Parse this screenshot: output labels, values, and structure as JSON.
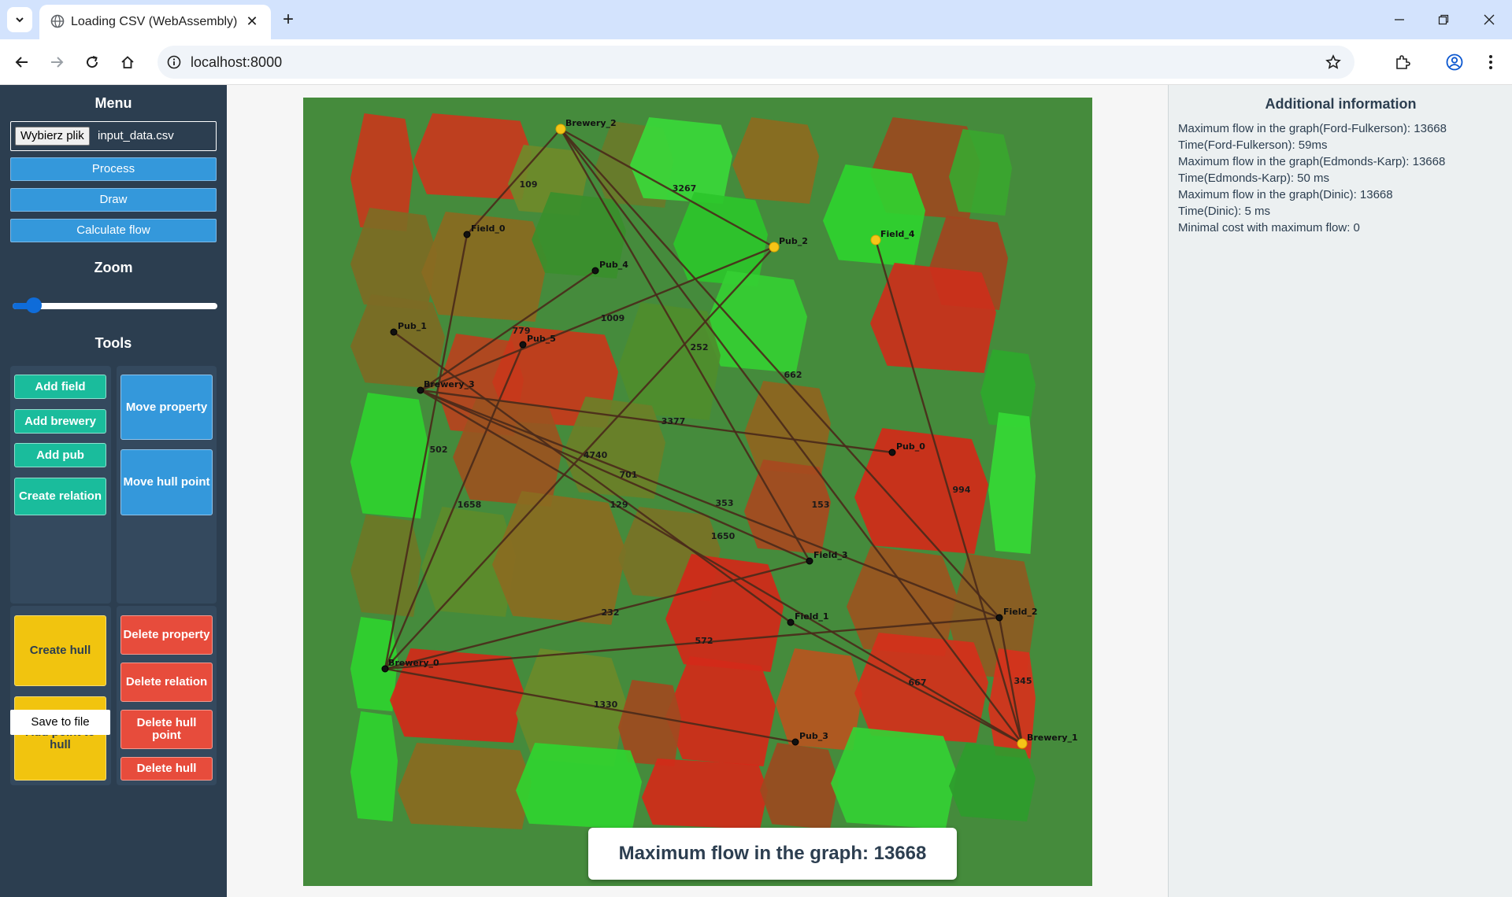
{
  "browser": {
    "tab_title": "Loading CSV (WebAssembly)",
    "url": "localhost:8000",
    "icons": [
      "chevron-down-icon",
      "globe-icon",
      "close-icon",
      "plus-icon",
      "minimize-icon",
      "restore-icon",
      "back-icon",
      "forward-icon",
      "reload-icon",
      "home-icon",
      "info-icon",
      "star-icon",
      "extensions-icon",
      "profile-icon",
      "kebab-menu-icon"
    ]
  },
  "sidebar": {
    "menu_title": "Menu",
    "file_button": "Wybierz plik",
    "file_name": "input_data.csv",
    "process_label": "Process",
    "draw_label": "Draw",
    "calculate_label": "Calculate flow",
    "zoom_title": "Zoom",
    "zoom_level": 0.07,
    "tools_title": "Tools",
    "tools": {
      "add_field": "Add field",
      "add_brewery": "Add brewery",
      "add_pub": "Add pub",
      "create_relation": "Create relation",
      "move_property": "Move property",
      "move_hull_point": "Move hull point",
      "create_hull": "Create hull",
      "add_point_to_hull": "Add point to hull",
      "delete_property": "Delete property",
      "delete_relation": "Delete relation",
      "delete_hull_point": "Delete hull point",
      "delete_hull": "Delete hull"
    },
    "save_label": "Save to file"
  },
  "map": {
    "nodes": [
      {
        "id": "Brewery_2",
        "type": "brewery"
      },
      {
        "id": "Field_0",
        "type": "field"
      },
      {
        "id": "Pub_4",
        "type": "pub"
      },
      {
        "id": "Pub_2",
        "type": "pub"
      },
      {
        "id": "Field_4",
        "type": "field"
      },
      {
        "id": "Pub_1",
        "type": "pub"
      },
      {
        "id": "Pub_5",
        "type": "pub"
      },
      {
        "id": "Brewery_3",
        "type": "brewery"
      },
      {
        "id": "Pub_0",
        "type": "pub"
      },
      {
        "id": "Field_3",
        "type": "field"
      },
      {
        "id": "Field_1",
        "type": "field"
      },
      {
        "id": "Field_2",
        "type": "field"
      },
      {
        "id": "Brewery_0",
        "type": "brewery"
      },
      {
        "id": "Pub_3",
        "type": "pub"
      },
      {
        "id": "Brewery_1",
        "type": "brewery"
      }
    ],
    "edge_labels": [
      "109",
      "3267",
      "1009",
      "779",
      "252",
      "662",
      "3377",
      "4740",
      "701",
      "502",
      "1658",
      "129",
      "353",
      "153",
      "994",
      "1650",
      "232",
      "572",
      "667",
      "345",
      "1330"
    ]
  },
  "flow_result": "Maximum flow in the graph: 13668",
  "info": {
    "title": "Additional information",
    "lines": [
      "Maximum flow in the graph(Ford-Fulkerson): 13668",
      "Time(Ford-Fulkerson): 59ms",
      "Maximum flow in the graph(Edmonds-Karp): 13668",
      "Time(Edmonds-Karp): 50 ms",
      "Maximum flow in the graph(Dinic): 13668",
      "Time(Dinic): 5 ms",
      "Minimal cost with maximum flow: 0"
    ]
  }
}
